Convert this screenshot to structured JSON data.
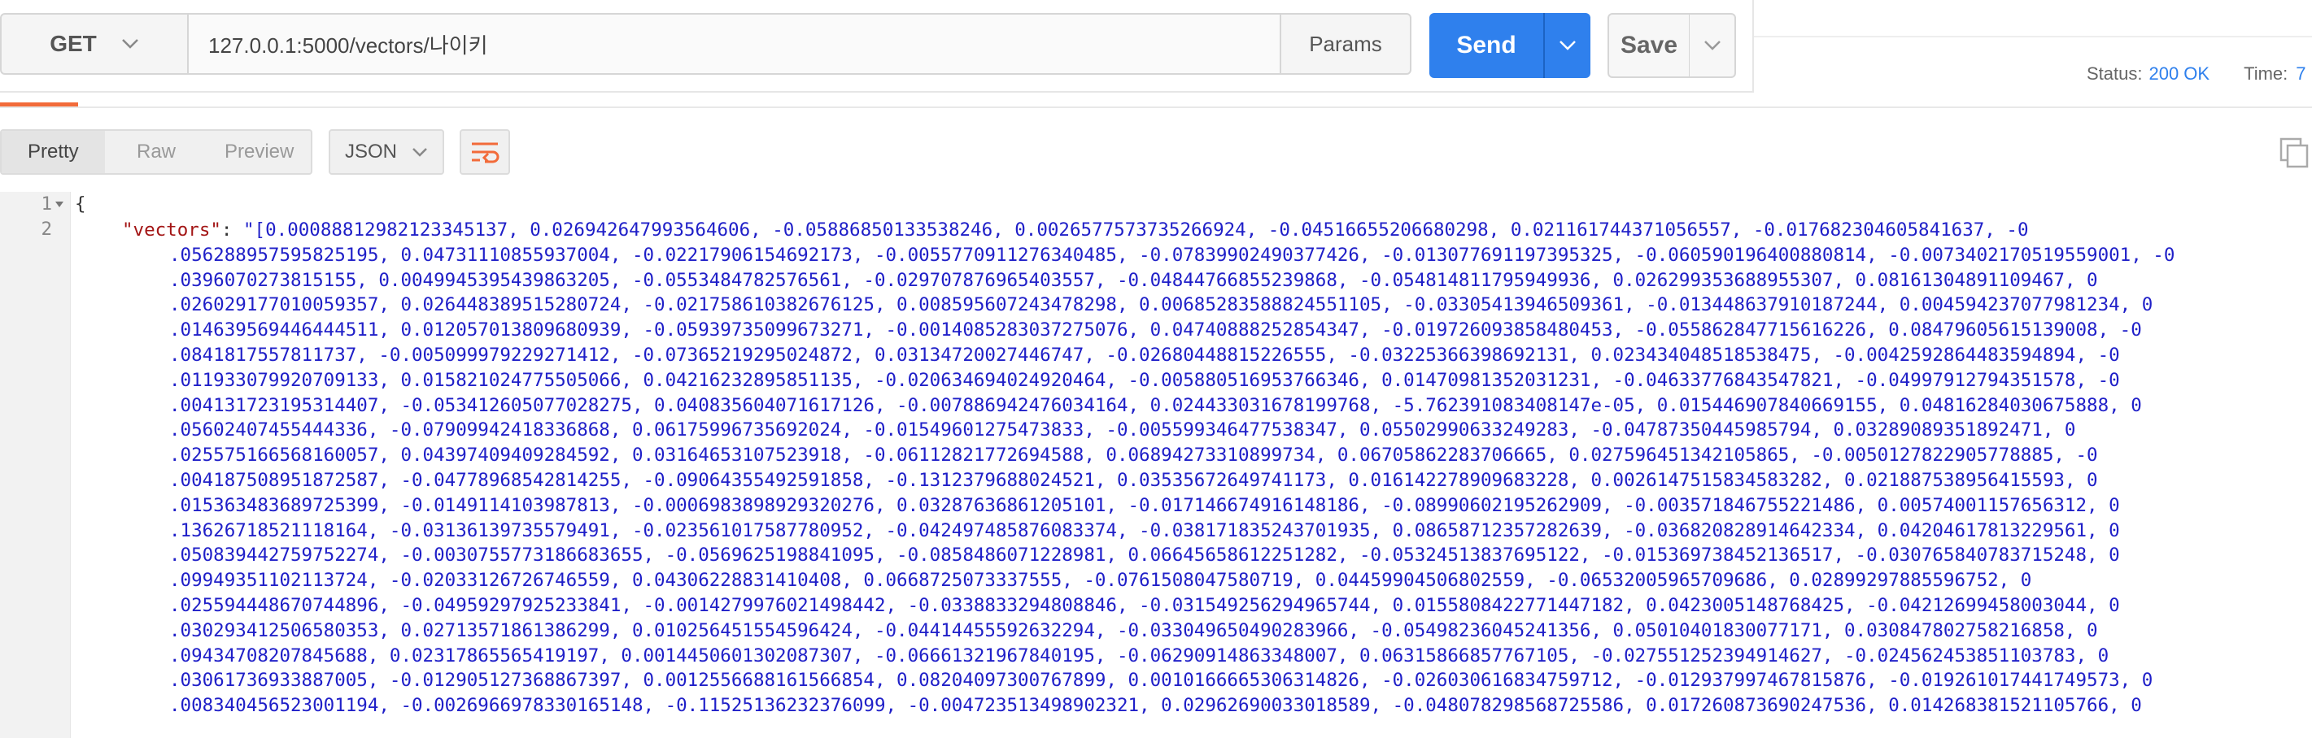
{
  "request": {
    "method": "GET",
    "url": "127.0.0.1:5000/vectors/나이키",
    "params_label": "Params",
    "send_label": "Send",
    "save_label": "Save"
  },
  "status": {
    "status_label": "Status:",
    "status_value": "200 OK",
    "time_label": "Time:",
    "time_value": "7"
  },
  "response_toolbar": {
    "views": [
      "Pretty",
      "Raw",
      "Preview"
    ],
    "format": "JSON"
  },
  "code": {
    "line_numbers": [
      "1",
      "2"
    ],
    "open_brace": "{",
    "key": "\"vectors\"",
    "colon": ": ",
    "value_lines": [
      "\"[0.00088812982123345137, 0.026942647993564606, -0.05886850133538246, 0.002657757373526​6924, -0.045166552066802​98, 0.02116174437105655​7, -0.017682304605841637, -0",
      ".056288957595825195, 0.04731110855937004, -0.02217906154692173, -0.0055770911276340485, -0.07839902490377426, -0.013077691197395325, -0.060590196400880814, -0.007340217​05195590​01, -0",
      ".0396070273815155, 0.004994539543986320​5, -0.0553484782576561, -0.029707876965403557, -0.04844766855239868, -0.05481481179594993​6, 0.026299353688955307, 0.08161304891109467, 0",
      ".026029177010059357, 0.026448389515280724, -0.021758610382676125, 0.008595607243478298, 0.006852835888245511​05, -0.033054139465093​61, -0.013448637910187244, 0.004594237077981234, 0",
      ".014639569446444511, 0.012057013809680939, -0.05939735099673271, -0.0014085283037275076, 0.04740888252854347, -0.019726093858480453, -0.055862847715616226, 0.08479605615139008, -0",
      ".0841817557811737, -0.005099979229271412, -0.07365219295024872, 0.03134720027446747, -0.02680448815226555, -0.03225366398692131, 0.023434048518538475, -0.0042592864483594894, -0",
      ".011933079920709133, 0.015821024775505066, 0.04216232895851135, -0.020634694024920464, -0.005880516953766346, 0.01470981352031231, -0.04633776843547821, -0.04997912794351578, -0",
      ".004131723195314407, -0.05341260507702827​5, 0.040835604071617126, -0.007886942476034164, 0.024433031678199768, -5.762391083408147e-05, 0.015446907840669155, 0.04816284030675888, 0",
      ".05602407455444336, -0.07909942418336868, 0.06175996735692024, -0.01549601275473833, -0.005599346477538347, 0.05502990633249283, -0.04787350445985794, 0.03289089351892471, 0",
      ".025575166568160057, 0.04397409409284592, 0.0316465310752391​8, -0.06112821772694588, 0.06894273310899734, 0.06705862283706665, 0.027596451342105865, -0.0050127822905778885, -0",
      ".004187508951872587, -0.04778968542814255, -0.09064355492591858, -0.1312379688024521, 0.03535672649741173, 0.016142278909683228, 0.002614751​5834583282, 0.021887538956415593, 0",
      ".015363483689725399, -0.014911410398781​3, -0.0006983898929320276, 0.03287636861205101, -0.017146674916148186, -0.08990602195262909, -0.003571846755221486, 0.00574001157656312, 0",
      ".13626718521118164, -0.03136139735579491, -0.023561017587780952, -0.042497485876083374, -0.03817183524370193​5, 0.08658712357282639, -0.036820828914642334, 0.04204617813229561, 0",
      ".050839442759752274, -0.0030755773186683655, -0.0569625198841095, -0.08584860712289​81, 0.06645658612251282, -0.05324513837695122, -0.015369738452136517, -0.030765840783715248, 0",
      ".09949351102113724, -0.02033126726746559, 0.04306228831410408, 0.06687250733375​55, -0.0761508047580719, 0.04459904506802559, -0.06532005965709686, 0.02899297885596752, 0",
      ".025594448670744896, -0.04959297925233841, -0.0014279976021498442, -0.0338833294808846, -0.031549256294965744, 0.01558084227714471​82, 0.0423005148768425, -0.04212699458003044, 0",
      ".030293412506580353, 0.02713571861386299, 0.010256451554596424, -0.04414455592632294, -0.033049650490283966, -0.05498236045241356, 0.05010401830077171, 0.030847802758216858, 0",
      ".09434708207845688, 0.02317865565419197, 0.0014450601302087307, -0.06661321967840195, -0.06290914863348007, 0.06315866857767105, -0.027551252394914627, -0.024562453851103783, 0",
      ".030617369338870​05, -0.012905127368867397, 0.0012556688161566854, 0.08204097300767899, 0.0010166665306314826, -0.026030616834759712, -0.012937997467815876, -0.019261017441749573, 0",
      ".008340456523001194, -0.0026966978330165148, -0.11525136232376099, -0.004723513498902321, 0.02962690033018589, -0.048078298568725586, 0.017260873690247536, 0.014268381521105766, 0"
    ]
  },
  "colors": {
    "accent": "#2f80ed",
    "tab_indicator": "#f26b3a",
    "json_key": "#a31515",
    "json_value": "#1f1fc8"
  },
  "icons": [
    "chevron-down-icon",
    "wrap-lines-icon",
    "copy-icon"
  ]
}
